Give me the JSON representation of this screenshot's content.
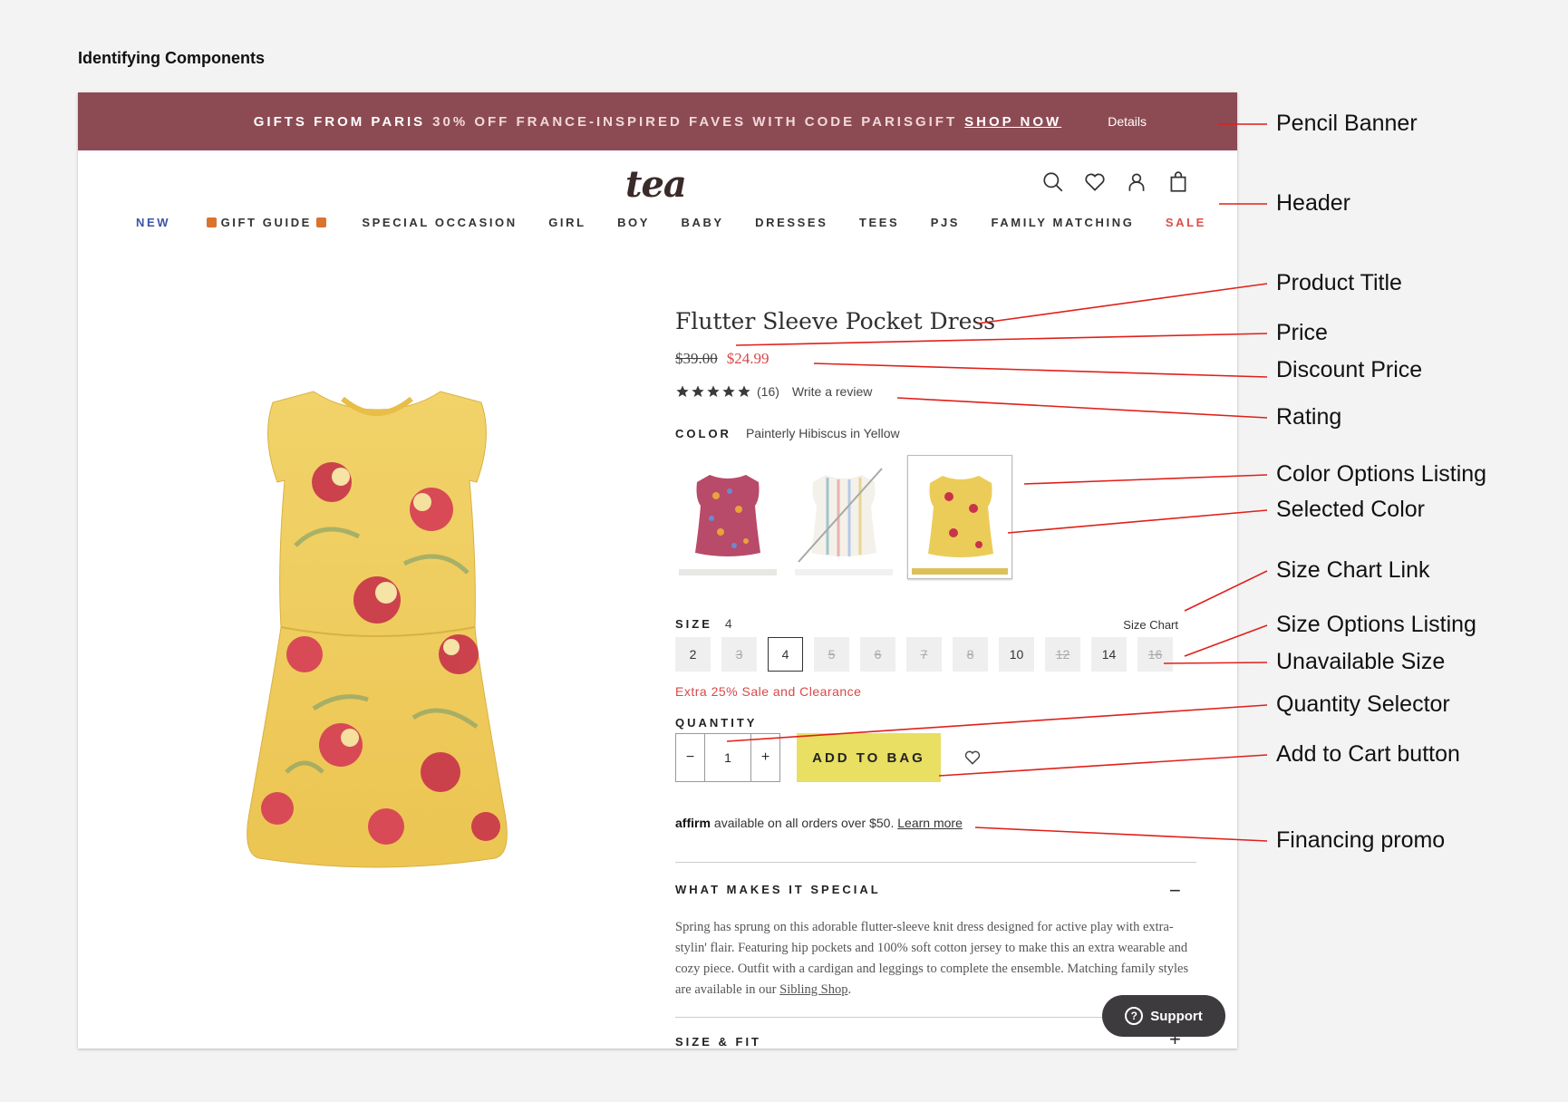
{
  "doc_title": "Identifying Components",
  "banner": {
    "lead": "GIFTS FROM PARIS",
    "offer": "30% OFF FRANCE-INSPIRED FAVES WITH CODE PARISGIFT",
    "cta": "SHOP NOW",
    "details": "Details"
  },
  "header": {
    "logo": "tea",
    "icons": [
      "search-icon",
      "heart-icon",
      "account-icon",
      "bag-icon"
    ],
    "nav": [
      "NEW",
      "GIFT GUIDE",
      "SPECIAL OCCASION",
      "GIRL",
      "BOY",
      "BABY",
      "DRESSES",
      "TEES",
      "PJS",
      "FAMILY MATCHING",
      "SALE"
    ]
  },
  "product": {
    "title": "Flutter Sleeve Pocket Dress",
    "original_price": "$39.00",
    "discount_price": "$24.99",
    "rating_stars": 5,
    "review_count": "(16)",
    "write_review": "Write a review",
    "color_label": "COLOR",
    "color_value": "Painterly Hibiscus in Yellow",
    "size_label": "SIZE",
    "size_value": "4",
    "size_chart": "Size Chart",
    "sizes": [
      {
        "label": "2",
        "available": true
      },
      {
        "label": "3",
        "available": false
      },
      {
        "label": "4",
        "available": true,
        "selected": true
      },
      {
        "label": "5",
        "available": false
      },
      {
        "label": "6",
        "available": false
      },
      {
        "label": "7",
        "available": false
      },
      {
        "label": "8",
        "available": false
      },
      {
        "label": "10",
        "available": true
      },
      {
        "label": "12",
        "available": false
      },
      {
        "label": "14",
        "available": true
      },
      {
        "label": "16",
        "available": false
      }
    ],
    "sale_note": "Extra 25% Sale and Clearance",
    "quantity_label": "QUANTITY",
    "quantity": "1",
    "minus": "−",
    "plus": "+",
    "add_to_bag": "ADD TO BAG",
    "affirm_brand": "affirm",
    "affirm_text": "available on all orders over $50.",
    "affirm_link": "Learn more",
    "special_title": "WHAT MAKES IT SPECIAL",
    "special_toggle": "−",
    "description": "Spring has sprung on this adorable flutter-sleeve knit dress designed for active play with extra-stylin' flair. Featuring hip pockets and 100% soft cotton jersey to make this an extra wearable and cozy piece. Outfit with a cardigan and leggings to complete the ensemble. Matching family styles are available in our",
    "description_link": "Sibling Shop",
    "description_end": ".",
    "size_fit_title": "SIZE & FIT",
    "size_fit_toggle": "+"
  },
  "support": "Support",
  "annotations": [
    "Pencil Banner",
    "Header",
    "Product Title",
    "Price",
    "Discount Price",
    "Rating",
    "Color Options Listing",
    "Selected Color",
    "Size Chart Link",
    "Size Options Listing",
    "Unavailable Size",
    "Quantity Selector",
    "Add to Cart button",
    "Financing promo"
  ],
  "colors": {
    "banner": "#8c4b53",
    "sale_red": "#d94848",
    "nav_new": "#3d53a6",
    "add_to_bag": "#e8df63",
    "annotation_line": "#e0201a"
  }
}
